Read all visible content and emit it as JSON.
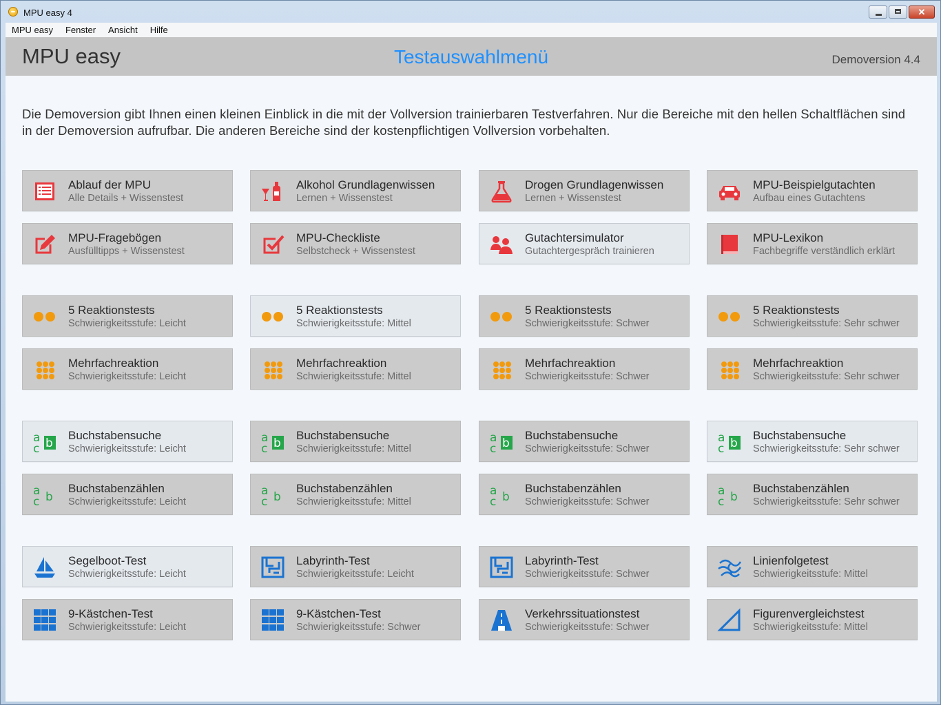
{
  "window": {
    "title": "MPU easy 4"
  },
  "menubar": [
    "MPU easy",
    "Fenster",
    "Ansicht",
    "Hilfe"
  ],
  "header": {
    "brand": "MPU easy",
    "title": "Testauswahlmenü",
    "version": "Demoversion 4.4"
  },
  "intro": "Die Demoversion gibt Ihnen einen kleinen Einblick in die mit der Vollversion trainierbaren Testverfahren. Nur die Bereiche mit den hellen Schaltflächen sind in der Demoversion aufrufbar. Die anderen Bereiche sind der kostenpflichtigen Vollversion vorbehalten.",
  "colors": {
    "red": "#e8383d",
    "orange": "#f29a0e",
    "green": "#26a64a",
    "blue": "#1a73d1",
    "title_blue": "#1e90ff"
  },
  "tiles": [
    {
      "title": "Ablauf der MPU",
      "subtitle": "Alle Details + Wissenstest",
      "icon": "list-icon",
      "light": false
    },
    {
      "title": "Alkohol Grundlagenwissen",
      "subtitle": "Lernen + Wissenstest",
      "icon": "bottle-icon",
      "light": false
    },
    {
      "title": "Drogen Grundlagenwissen",
      "subtitle": "Lernen + Wissenstest",
      "icon": "flask-icon",
      "light": false
    },
    {
      "title": "MPU-Beispielgutachten",
      "subtitle": "Aufbau eines Gutachtens",
      "icon": "car-icon",
      "light": false
    },
    {
      "title": "MPU-Fragebögen",
      "subtitle": "Ausfülltipps + Wissenstest",
      "icon": "edit-icon",
      "light": false
    },
    {
      "title": "MPU-Checkliste",
      "subtitle": "Selbstcheck + Wissenstest",
      "icon": "checkbox-icon",
      "light": false
    },
    {
      "title": "Gutachtersimulator",
      "subtitle": "Gutachtergespräch trainieren",
      "icon": "interview-icon",
      "light": true
    },
    {
      "title": "MPU-Lexikon",
      "subtitle": "Fachbegriffe verständlich erklärt",
      "icon": "book-icon",
      "light": false
    },
    {
      "title": "5 Reaktionstests",
      "subtitle": "Schwierigkeitsstufe: Leicht",
      "icon": "two-dots-icon",
      "light": false
    },
    {
      "title": "5 Reaktionstests",
      "subtitle": "Schwierigkeitsstufe: Mittel",
      "icon": "two-dots-icon",
      "light": true
    },
    {
      "title": "5 Reaktionstests",
      "subtitle": "Schwierigkeitsstufe: Schwer",
      "icon": "two-dots-icon",
      "light": false
    },
    {
      "title": "5 Reaktionstests",
      "subtitle": "Schwierigkeitsstufe: Sehr schwer",
      "icon": "two-dots-icon",
      "light": false
    },
    {
      "title": "Mehrfachreaktion",
      "subtitle": "Schwierigkeitsstufe: Leicht",
      "icon": "dot-grid-icon",
      "light": false
    },
    {
      "title": "Mehrfachreaktion",
      "subtitle": "Schwierigkeitsstufe: Mittel",
      "icon": "dot-grid-icon",
      "light": false
    },
    {
      "title": "Mehrfachreaktion",
      "subtitle": "Schwierigkeitsstufe: Schwer",
      "icon": "dot-grid-icon",
      "light": false
    },
    {
      "title": "Mehrfachreaktion",
      "subtitle": "Schwierigkeitsstufe: Sehr schwer",
      "icon": "dot-grid-icon",
      "light": false
    },
    {
      "title": "Buchstabensuche",
      "subtitle": "Schwierigkeitsstufe: Leicht",
      "icon": "letters-search-icon",
      "light": true
    },
    {
      "title": "Buchstabensuche",
      "subtitle": "Schwierigkeitsstufe: Mittel",
      "icon": "letters-search-icon",
      "light": false
    },
    {
      "title": "Buchstabensuche",
      "subtitle": "Schwierigkeitsstufe: Schwer",
      "icon": "letters-search-icon",
      "light": false
    },
    {
      "title": "Buchstabensuche",
      "subtitle": "Schwierigkeitsstufe: Sehr schwer",
      "icon": "letters-search-icon",
      "light": true
    },
    {
      "title": "Buchstabenzählen",
      "subtitle": "Schwierigkeitsstufe: Leicht",
      "icon": "letters-count-icon",
      "light": false
    },
    {
      "title": "Buchstabenzählen",
      "subtitle": "Schwierigkeitsstufe: Mittel",
      "icon": "letters-count-icon",
      "light": false
    },
    {
      "title": "Buchstabenzählen",
      "subtitle": "Schwierigkeitsstufe: Schwer",
      "icon": "letters-count-icon",
      "light": false
    },
    {
      "title": "Buchstabenzählen",
      "subtitle": "Schwierigkeitsstufe: Sehr schwer",
      "icon": "letters-count-icon",
      "light": false
    },
    {
      "title": "Segelboot-Test",
      "subtitle": "Schwierigkeitsstufe: Leicht",
      "icon": "sailboat-icon",
      "light": true
    },
    {
      "title": "Labyrinth-Test",
      "subtitle": "Schwierigkeitsstufe: Leicht",
      "icon": "maze-icon",
      "light": false
    },
    {
      "title": "Labyrinth-Test",
      "subtitle": "Schwierigkeitsstufe: Schwer",
      "icon": "maze-icon",
      "light": false
    },
    {
      "title": "Linienfolgetest",
      "subtitle": "Schwierigkeitsstufe: Mittel",
      "icon": "lines-icon",
      "light": false
    },
    {
      "title": "9-Kästchen-Test",
      "subtitle": "Schwierigkeitsstufe: Leicht",
      "icon": "nine-grid-icon",
      "light": false
    },
    {
      "title": "9-Kästchen-Test",
      "subtitle": "Schwierigkeitsstufe: Schwer",
      "icon": "nine-grid-icon",
      "light": false
    },
    {
      "title": "Verkehrssituationstest",
      "subtitle": "Schwierigkeitsstufe: Schwer",
      "icon": "road-icon",
      "light": false
    },
    {
      "title": "Figurenvergleichstest",
      "subtitle": "Schwierigkeitsstufe: Mittel",
      "icon": "triangle-icon",
      "light": false
    }
  ]
}
